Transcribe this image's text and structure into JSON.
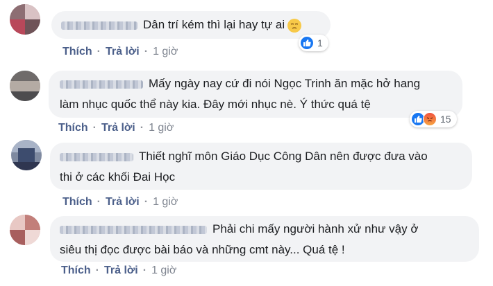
{
  "actions": {
    "like": "Thích",
    "reply": "Trả lời",
    "separator": "·"
  },
  "comments": [
    {
      "text_lines": [
        "Dân trí kém thì lại hay tự ai"
      ],
      "emoji": "pensive-emoji",
      "time": "1 giờ",
      "reactions": {
        "icons": [
          "like-icon"
        ],
        "count": "1"
      }
    },
    {
      "text_lines": [
        "Mấy ngày nay cứ đi nói Ngọc Trinh ăn mặc hở hang",
        "làm nhục quốc thể này kia. Đây mới nhục nè. Ý thức quá tệ"
      ],
      "time": "1 giờ",
      "reactions": {
        "icons": [
          "like-icon",
          "angry-icon"
        ],
        "count": "15"
      }
    },
    {
      "text_lines": [
        "Thiết nghĩ môn Giáo Dục Công Dân nên được đưa vào",
        "thi ở các khối Đai Học"
      ],
      "time": "1 giờ"
    },
    {
      "text_lines": [
        "Phải chi mấy người hành xử như vậy ở",
        "siêu thị đọc được bài báo và những cmt này... Quá tệ !"
      ],
      "time": "1 giờ"
    }
  ],
  "colors": {
    "bubble": "#f2f3f5",
    "link": "#4b5f8a",
    "like": "#1877f2"
  }
}
